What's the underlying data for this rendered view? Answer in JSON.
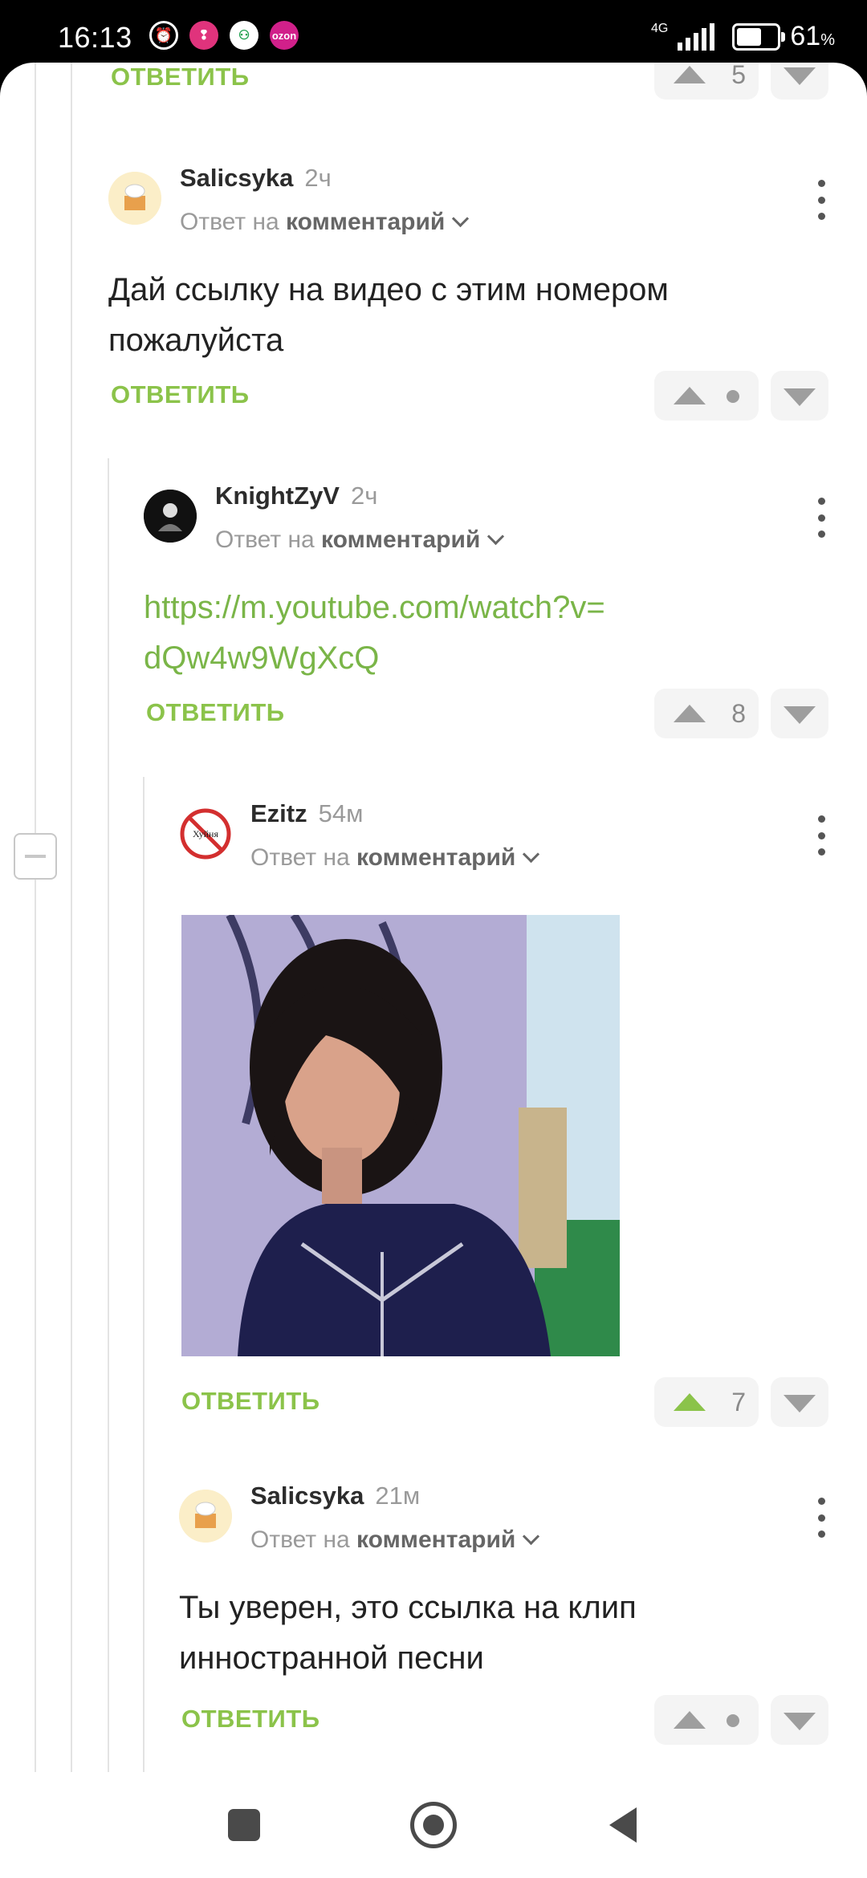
{
  "status_bar": {
    "time": "16:13",
    "network": "4G",
    "battery_percent": "61",
    "battery_unit": "%",
    "battery_level": 0.61,
    "app_icons": [
      "alarm-icon",
      "app-icon",
      "app-icon",
      "ozon-icon"
    ],
    "ozon_label": "ozon"
  },
  "thread": {
    "top_partial": {
      "reply_label": "ОТВЕТИТЬ",
      "votes": "5"
    },
    "comments": [
      {
        "author": "Salicsyka",
        "time": "2ч",
        "reply_prefix": "Ответ на",
        "reply_target": "комментарий",
        "text": "Дай ссылку на видео с этим номером пожалуйста",
        "reply_label": "ОТВЕТИТЬ",
        "votes": null
      },
      {
        "author": "KnightZyV",
        "time": "2ч",
        "reply_prefix": "Ответ на",
        "reply_target": "комментарий",
        "link_line1": "https://m.youtube.com/watch?v=",
        "link_line2": "dQw4w9WgXcQ",
        "reply_label": "ОТВЕТИТЬ",
        "votes": "8"
      },
      {
        "author": "Ezitz",
        "time": "54м",
        "reply_prefix": "Ответ на",
        "reply_target": "комментарий",
        "avatar_text": "Хуйня",
        "reply_label": "ОТВЕТИТЬ",
        "votes": "7"
      },
      {
        "author": "Salicsyka",
        "time": "21м",
        "reply_prefix": "Ответ на",
        "reply_target": "комментарий",
        "text": "Ты уверен, это ссылка на клип инностранной песни",
        "reply_label": "ОТВЕТИТЬ",
        "votes": null
      }
    ]
  },
  "colors": {
    "accent_green": "#8bc34a",
    "link_green": "#7ab548"
  }
}
